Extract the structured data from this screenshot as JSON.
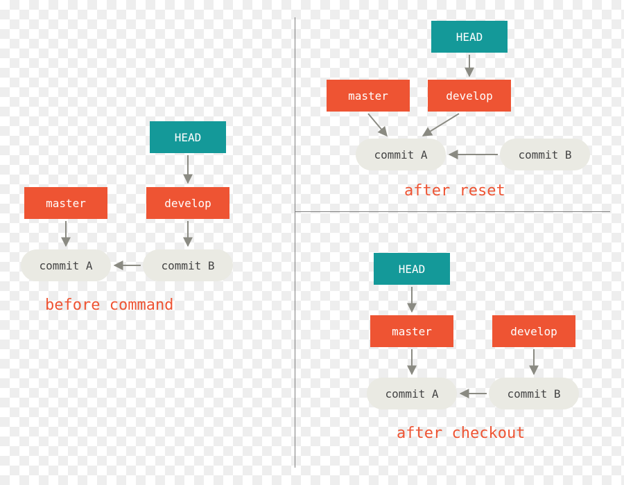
{
  "colors": {
    "head": "#149999",
    "branch": "#ee5433",
    "commit_bg": "#eaeae3",
    "commit_fg": "#444444",
    "caption": "#ee5433",
    "divider": "#7f7f7f",
    "arrow": "#8a8a82"
  },
  "labels": {
    "head": "HEAD",
    "master": "master",
    "develop": "develop",
    "commit_a": "commit A",
    "commit_b": "commit B"
  },
  "captions": {
    "before": "before command",
    "after_reset": "after reset",
    "after_checkout": "after checkout"
  },
  "scenarios": {
    "before": {
      "head_points_to": "develop",
      "master_points_to": "commit A",
      "develop_points_to": "commit B",
      "commit_b_parent": "commit A"
    },
    "after_reset": {
      "head_points_to": "develop",
      "master_points_to": "commit A",
      "develop_points_to": "commit A",
      "commit_b_parent": "commit A"
    },
    "after_checkout": {
      "head_points_to": "master",
      "master_points_to": "commit A",
      "develop_points_to": "commit B",
      "commit_b_parent": "commit A"
    }
  }
}
